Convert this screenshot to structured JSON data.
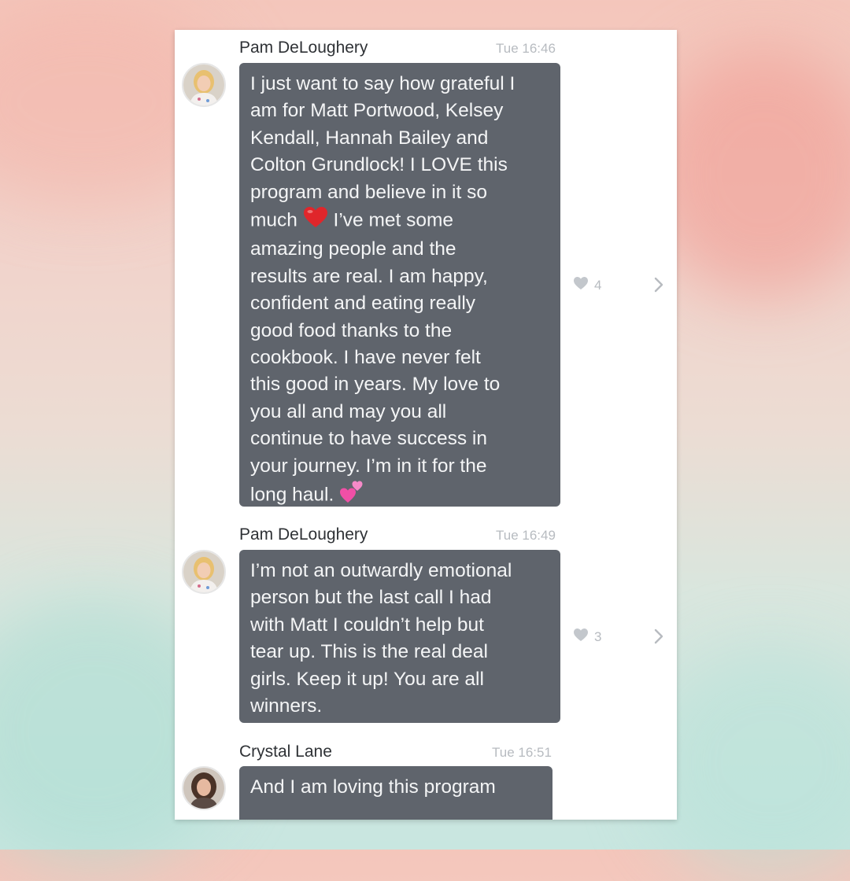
{
  "messages": [
    {
      "sender": "Pam DeLoughery",
      "time": "Tue 16:46",
      "lines": [
        "I just want to say how grateful I",
        "am for Matt Portwood, Kelsey",
        "Kendall, Hannah Bailey and",
        "Colton Grundlock! I LOVE this",
        "program and believe in it so",
        "much ",
        "amazing people and the",
        "results are real. I am happy,",
        "confident and eating really",
        "good food thanks to the",
        "cookbook. I have never felt",
        "this good in years. My love to",
        "you all and may you all",
        "continue to have success in",
        "your journey. I’m in it for the",
        "long haul. "
      ],
      "line6_after_emoji": " I’ve met some",
      "emoji_icons": [
        "red-heart-emoji",
        "two-hearts-emoji"
      ],
      "likes": "4"
    },
    {
      "sender": "Pam DeLoughery",
      "time": "Tue 16:49",
      "lines": [
        "I’m not an outwardly emotional",
        "person but the last call I had",
        "with Matt I couldn’t help but",
        "tear up. This is the real deal",
        "girls. Keep it up! You are all",
        "winners."
      ],
      "likes": "3"
    },
    {
      "sender": "Crystal Lane",
      "time": "Tue 16:51",
      "lines": [
        "And I am loving this program"
      ]
    }
  ],
  "colors": {
    "bubble": "#5f646c",
    "bubble_text": "#f4f5f6",
    "meta_text": "#b7bbc0",
    "heart_emoji": "#e0262b",
    "pink_hearts": "#f04fa6"
  },
  "icons": {
    "like": "heart-icon",
    "open": "chevron-right-icon"
  }
}
